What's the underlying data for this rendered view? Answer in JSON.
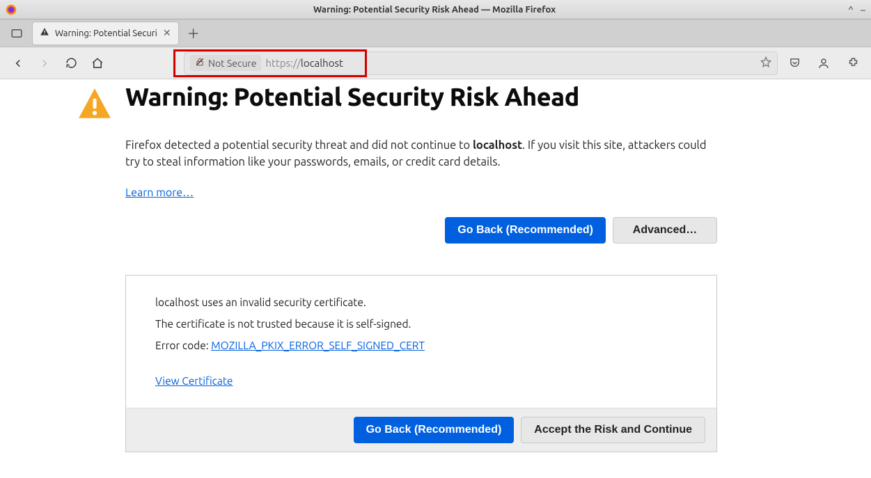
{
  "window": {
    "title": "Warning: Potential Security Risk Ahead — Mozilla Firefox"
  },
  "tab": {
    "title": "Warning: Potential Securi"
  },
  "urlbar": {
    "not_secure_label": "Not Secure",
    "scheme": "https://",
    "domain": "localhost"
  },
  "page": {
    "heading": "Warning: Potential Security Risk Ahead",
    "desc_pre": "Firefox detected a potential security threat and did not continue to ",
    "desc_domain": "localhost",
    "desc_post": ". If you visit this site, attackers could try to steal information like your passwords, emails, or credit card details.",
    "learn_more": "Learn more…",
    "go_back_label": "Go Back (Recommended)",
    "advanced_label": "Advanced…"
  },
  "advanced": {
    "line1": "localhost uses an invalid security certificate.",
    "line2": "The certificate is not trusted because it is self-signed.",
    "error_label": "Error code: ",
    "error_code": "MOZILLA_PKIX_ERROR_SELF_SIGNED_CERT",
    "view_cert": "View Certificate",
    "go_back_label": "Go Back (Recommended)",
    "accept_label": "Accept the Risk and Continue"
  }
}
